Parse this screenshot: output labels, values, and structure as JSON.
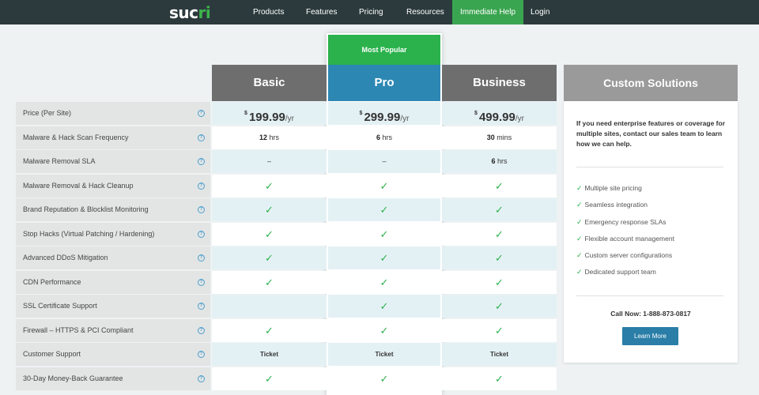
{
  "nav": {
    "logo": {
      "prefix": "suc",
      "highlight": "ri"
    },
    "items": [
      "Products",
      "Features",
      "Pricing",
      "Resources",
      "Immediate Help",
      "Login"
    ]
  },
  "badge": "Most Popular",
  "plans": [
    {
      "name": "Basic",
      "currency": "$",
      "price": "199.99",
      "period": "/yr"
    },
    {
      "name": "Pro",
      "currency": "$",
      "price": "299.99",
      "period": "/yr"
    },
    {
      "name": "Business",
      "currency": "$",
      "price": "499.99",
      "period": "/yr"
    }
  ],
  "help_icon": "?",
  "features": [
    {
      "label": "Price (Per Site)"
    },
    {
      "label": "Malware & Hack Scan Frequency",
      "values": [
        {
          "num": "12",
          "unit": " hrs"
        },
        {
          "num": "6",
          "unit": " hrs"
        },
        {
          "num": "30",
          "unit": " mins"
        }
      ]
    },
    {
      "label": "Malware Removal SLA",
      "values": [
        {
          "text": "–"
        },
        {
          "text": "–"
        },
        {
          "num": "6",
          "unit": " hrs"
        }
      ]
    },
    {
      "label": "Malware Removal & Hack Cleanup"
    },
    {
      "label": "Brand Reputation & Blocklist Monitoring"
    },
    {
      "label": "Stop Hacks (Virtual Patching / Hardening)"
    },
    {
      "label": "Advanced DDoS Mitigation"
    },
    {
      "label": "CDN Performance"
    },
    {
      "label": "SSL Certificate Support"
    },
    {
      "label": "Firewall – HTTPS & PCI Compliant"
    },
    {
      "label": "Customer Support",
      "values": [
        {
          "text": "Ticket"
        },
        {
          "text": "Ticket"
        },
        {
          "text": "Ticket"
        }
      ]
    },
    {
      "label": "30-Day Money-Back Guarantee"
    }
  ],
  "check_mark": "✓",
  "custom": {
    "title": "Custom Solutions",
    "intro": "If you need enterprise features or coverage for multiple sites, contact our sales team to learn how we can help.",
    "features": [
      "Multiple site pricing",
      "Seamless integration",
      "Emergency response SLAs",
      "Flexible account management",
      "Custom server configurations",
      "Dedicated support team"
    ],
    "call": "Call Now: 1-888-873-0817",
    "button": "Learn More"
  },
  "colors": {
    "nav_bg": "#2c3a3d",
    "help_green": "#3aa550",
    "pro_blue": "#2d87b3",
    "popular_green": "#2bb24c",
    "plan_gray": "#6e6e6e",
    "check_green": "#2bb24c"
  }
}
